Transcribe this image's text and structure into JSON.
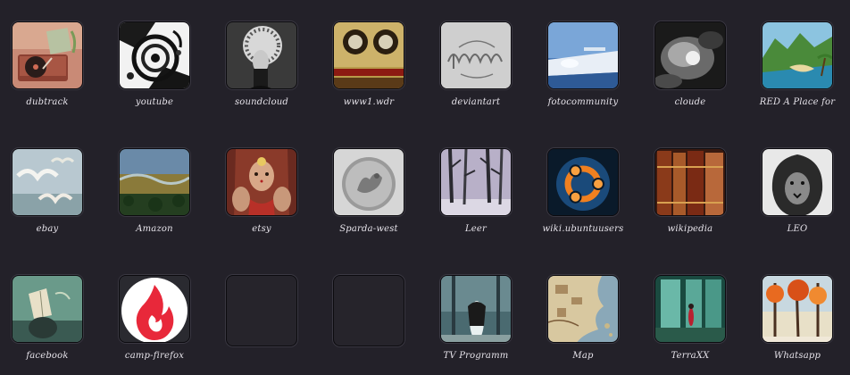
{
  "tiles": [
    {
      "label": "dubtrack",
      "icon": "record-player-icon"
    },
    {
      "label": "youtube",
      "icon": "ink-swirl-icon"
    },
    {
      "label": "soundcloud",
      "icon": "masked-face-icon"
    },
    {
      "label": "www1.wdr",
      "icon": "vintage-radio-icon"
    },
    {
      "label": "deviantart",
      "icon": "deviant-script-icon"
    },
    {
      "label": "fotocommunity",
      "icon": "snow-landscape-icon"
    },
    {
      "label": "cloude",
      "icon": "storm-cloud-icon"
    },
    {
      "label": "RED A Place for",
      "icon": "tropical-coast-icon"
    },
    {
      "label": "ebay",
      "icon": "seagulls-icon"
    },
    {
      "label": "Amazon",
      "icon": "river-aerial-icon"
    },
    {
      "label": "etsy",
      "icon": "decorated-woman-icon"
    },
    {
      "label": "Sparda-west",
      "icon": "silver-coin-icon"
    },
    {
      "label": "Leer",
      "icon": "winter-forest-icon"
    },
    {
      "label": "wiki.ubuntuusers",
      "icon": "ubuntu-logo-icon"
    },
    {
      "label": "wikipedia",
      "icon": "old-books-icon"
    },
    {
      "label": "LEO",
      "icon": "lion-drawing-icon"
    },
    {
      "label": "facebook",
      "icon": "reading-figure-icon"
    },
    {
      "label": "camp-firefox",
      "icon": "flame-logo-icon"
    },
    {
      "label": "",
      "icon": "empty-slot"
    },
    {
      "label": "",
      "icon": "empty-slot"
    },
    {
      "label": "TV Programm",
      "icon": "ghost-girl-icon"
    },
    {
      "label": "Map",
      "icon": "fantasy-map-icon"
    },
    {
      "label": "TerraXX",
      "icon": "green-hall-icon"
    },
    {
      "label": "Whatsapp",
      "icon": "autumn-forest-icon"
    }
  ]
}
